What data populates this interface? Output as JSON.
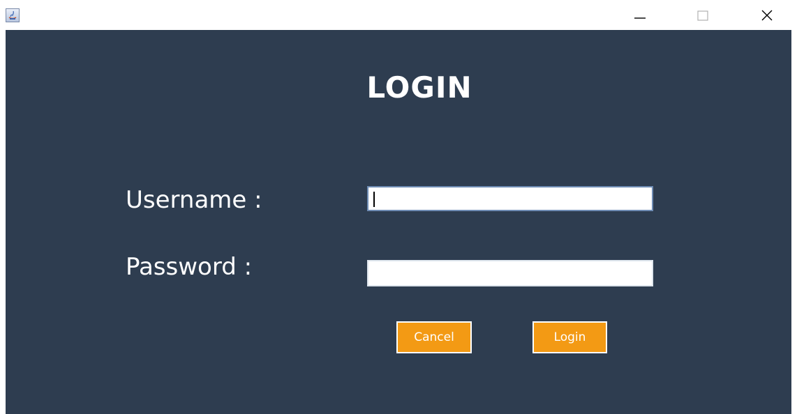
{
  "window": {
    "icon": "java-cup-icon",
    "controls": {
      "minimize": "minimize-icon",
      "maximize": "maximize-icon",
      "close": "close-icon"
    }
  },
  "form": {
    "heading": "LOGIN",
    "username_label": "Username :",
    "username_value": "",
    "password_label": "Password  :",
    "password_value": ""
  },
  "buttons": {
    "cancel_label": "Cancel",
    "login_label": "Login"
  },
  "colors": {
    "panel_bg": "#2e3d50",
    "button_bg": "#f39a14",
    "text": "#ffffff"
  }
}
